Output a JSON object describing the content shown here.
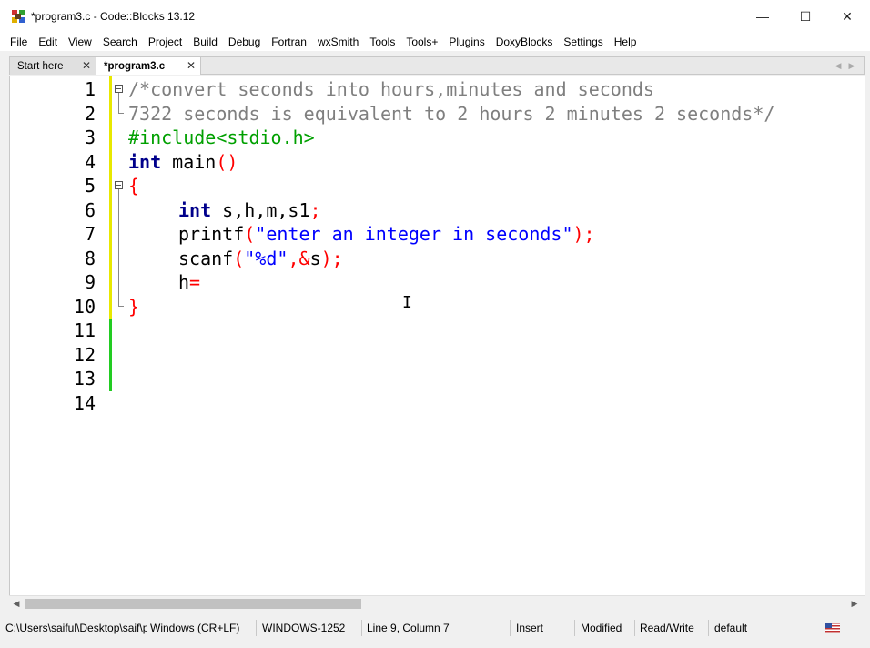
{
  "window": {
    "title": "*program3.c - Code::Blocks 13.12",
    "minimize_glyph": "—",
    "maximize_glyph": "☐",
    "close_glyph": "✕"
  },
  "menu": {
    "items": [
      "File",
      "Edit",
      "View",
      "Search",
      "Project",
      "Build",
      "Debug",
      "Fortran",
      "wxSmith",
      "Tools",
      "Tools+",
      "Plugins",
      "DoxyBlocks",
      "Settings",
      "Help"
    ]
  },
  "tabs": [
    {
      "label": "Start here",
      "close": "✕",
      "active": false
    },
    {
      "label": "*program3.c",
      "close": "✕",
      "active": true
    }
  ],
  "editor": {
    "line_numbers": [
      "1",
      "2",
      "3",
      "4",
      "5",
      "6",
      "7",
      "8",
      "9",
      "10",
      "11",
      "12",
      "13",
      "14"
    ],
    "lines": {
      "l1": "/*convert seconds into hours,minutes and seconds",
      "l2": "7322 seconds is equivalent to 2 hours 2 minutes 2 seconds*/",
      "l3": "#include<stdio.h>",
      "l4_kw": "int",
      "l4_name": " main",
      "l4_paren": "()",
      "l5": "{",
      "l6_kw": "int",
      "l6_vars": " s,h,m,s1",
      "l6_semi": ";",
      "l7_fn": "printf",
      "l7_open": "(",
      "l7_str": "\"enter an integer in seconds\"",
      "l7_close": ");",
      "l8_fn": "scanf",
      "l8_open": "(",
      "l8_str": "\"%d\"",
      "l8_comma": ",&",
      "l8_var": "s",
      "l8_close": ");",
      "l9_var": "h",
      "l9_op": "=",
      "l10": "}"
    },
    "cursor_glyph": "I"
  },
  "colors": {
    "comment": "#7f7f7f",
    "preprocessor": "#00a000",
    "keyword": "#00008b",
    "string": "#0000ff",
    "operator": "#ff0000",
    "changed_saved": "#e8e800",
    "changed_unsaved": "#22cc22"
  },
  "scrollbar": {
    "left_arrow": "◀",
    "right_arrow": "▶"
  },
  "status": {
    "path": "C:\\Users\\saiful\\Desktop\\saif\\p",
    "line_endings": "Windows (CR+LF)",
    "encoding": "WINDOWS-1252",
    "position": "Line 9, Column 7",
    "mode": "Insert",
    "modified": "Modified",
    "access": "Read/Write",
    "lexer": "default"
  },
  "icons": {
    "app": "codeblocks-icon",
    "flag": "us-flag-icon"
  }
}
